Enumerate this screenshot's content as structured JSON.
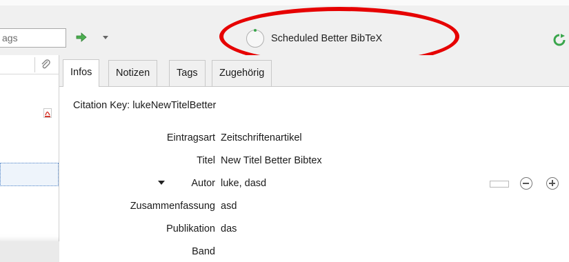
{
  "toolbar": {
    "search_value": "ags",
    "status_text": "Scheduled Better BibTeX"
  },
  "tabs": [
    {
      "label": "Infos"
    },
    {
      "label": "Notizen"
    },
    {
      "label": "Tags"
    },
    {
      "label": "Zugehörig"
    }
  ],
  "info": {
    "citation": "Citation Key: lukeNewTitelBetter",
    "fields": [
      {
        "label": "Eintragsart",
        "value": "Zeitschriftenartikel"
      },
      {
        "label": "Titel",
        "value": "New Titel Better Bibtex"
      },
      {
        "label": "Autor",
        "value": "luke, dasd"
      },
      {
        "label": "Zusammenfassung",
        "value": "asd"
      },
      {
        "label": "Publikation",
        "value": "das"
      },
      {
        "label": "Band",
        "value": ""
      }
    ]
  },
  "colors": {
    "highlight": "#e60000",
    "toolbar_bg": "#f0f0f0",
    "selection_border": "#4a7fc5",
    "green_icon": "#3aa64c"
  },
  "icons": [
    "forward-arrow-icon",
    "chevron-down-icon",
    "spinner-icon",
    "sync-icon",
    "paperclip-icon",
    "pdf-icon",
    "twisty-down-icon",
    "minus-circle-icon",
    "plus-circle-icon"
  ]
}
